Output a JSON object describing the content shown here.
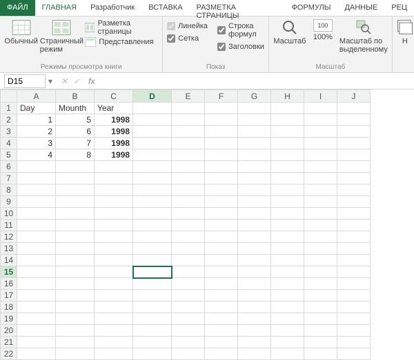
{
  "tabs": {
    "file": "ФАЙЛ",
    "items": [
      "ГЛАВНАЯ",
      "Разработчик",
      "ВСТАВКА",
      "РАЗМЕТКА СТРАНИЦЫ",
      "ФОРМУЛЫ",
      "ДАННЫЕ",
      "РЕЦ"
    ]
  },
  "ribbon": {
    "views_group_label": "Режимы просмотра книги",
    "show_group_label": "Показ",
    "zoom_group_label": "Масштаб",
    "normal": "Обычный",
    "page_break": "Страничный режим",
    "page_layout": "Разметка страницы",
    "custom_views": "Представления",
    "ruler": "Линейка",
    "grid": "Сетка",
    "formula_bar": "Строка формул",
    "headings": "Заголовки",
    "zoom": "Масштаб",
    "zoom100": "100%",
    "zoom_sel": "Масштаб по выделенному",
    "new_prefix": "Н"
  },
  "formula_bar": {
    "name_box": "D15",
    "fx_label": "fx",
    "cancel": "✕",
    "accept": "✓",
    "value": ""
  },
  "grid": {
    "columns": [
      "A",
      "B",
      "C",
      "D",
      "E",
      "F",
      "G",
      "H",
      "I",
      "J"
    ],
    "selected_col": "D",
    "selected_row": 15,
    "row_count": 22,
    "headers": {
      "A": "Day",
      "B": "Mounth",
      "C": "Year"
    },
    "data": [
      {
        "A": "1",
        "B": "5",
        "C": "1998"
      },
      {
        "A": "2",
        "B": "6",
        "C": "1998"
      },
      {
        "A": "3",
        "B": "7",
        "C": "1998"
      },
      {
        "A": "4",
        "B": "8",
        "C": "1998"
      }
    ]
  }
}
